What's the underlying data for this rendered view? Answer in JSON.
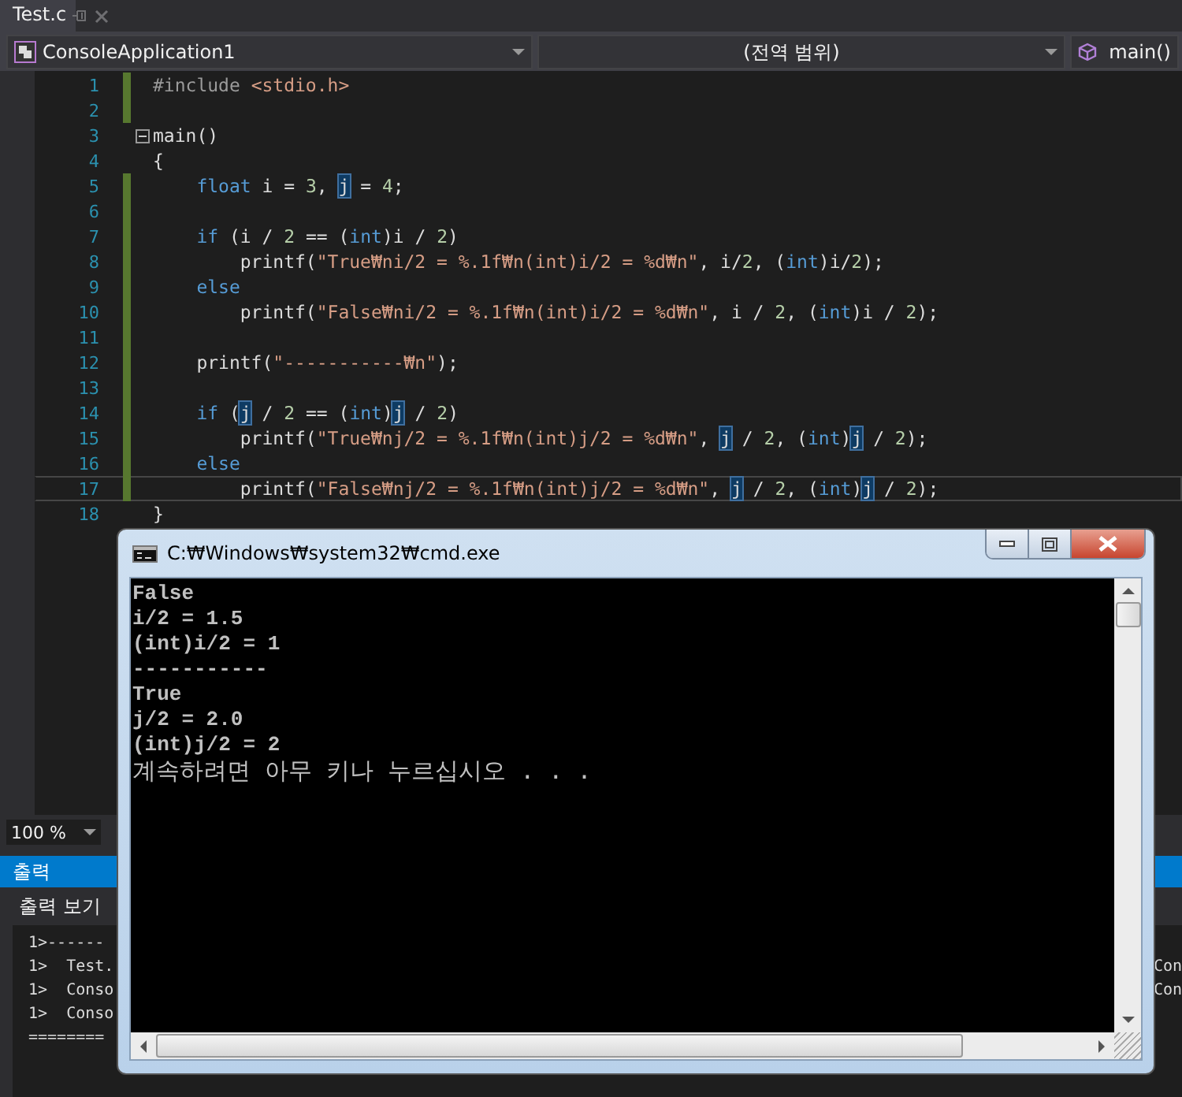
{
  "tab": {
    "title": "Test.c",
    "selected": true
  },
  "nav": {
    "project": "ConsoleApplication1",
    "scope": "(전역 범위)",
    "member": "main()"
  },
  "code_lines": [
    {
      "number": "1",
      "changed": true,
      "fold": false,
      "current": false,
      "tokens": [
        {
          "kind": "directive",
          "text": "#include "
        },
        {
          "kind": "string",
          "text": "<stdio.h>"
        }
      ]
    },
    {
      "number": "2",
      "changed": true,
      "fold": false,
      "current": false
    },
    {
      "number": "3",
      "changed": false,
      "fold": true,
      "current": false,
      "tokens": [
        {
          "kind": "plain",
          "text": "main()"
        }
      ]
    },
    {
      "number": "4",
      "changed": false,
      "fold": false,
      "current": false,
      "tokens": [
        {
          "kind": "plain",
          "text": "{"
        }
      ]
    },
    {
      "number": "5",
      "changed": true,
      "fold": false,
      "current": false,
      "tokens": [
        {
          "kind": "keyword",
          "text": "    float"
        },
        {
          "kind": "plain",
          "text": " i = "
        },
        {
          "kind": "number",
          "text": "3"
        },
        {
          "kind": "plain",
          "text": ", "
        },
        {
          "kind": "ref",
          "text": "j"
        },
        {
          "kind": "plain",
          "text": " = "
        },
        {
          "kind": "number",
          "text": "4"
        },
        {
          "kind": "plain",
          "text": ";"
        }
      ]
    },
    {
      "number": "6",
      "changed": true,
      "fold": false,
      "current": false
    },
    {
      "number": "7",
      "changed": true,
      "fold": false,
      "current": false,
      "tokens": [
        {
          "kind": "keyword",
          "text": "    if"
        },
        {
          "kind": "plain",
          "text": " (i / "
        },
        {
          "kind": "number",
          "text": "2"
        },
        {
          "kind": "plain",
          "text": " == ("
        },
        {
          "kind": "keyword",
          "text": "int"
        },
        {
          "kind": "plain",
          "text": ")i / "
        },
        {
          "kind": "number",
          "text": "2"
        },
        {
          "kind": "plain",
          "text": ")"
        }
      ]
    },
    {
      "number": "8",
      "changed": true,
      "fold": false,
      "current": false,
      "tokens": [
        {
          "kind": "plain",
          "text": "        printf("
        },
        {
          "kind": "string",
          "text": "\"True₩ni/2 = %.1f₩n(int)i/2 = %d₩n\""
        },
        {
          "kind": "plain",
          "text": ", i/"
        },
        {
          "kind": "number",
          "text": "2"
        },
        {
          "kind": "plain",
          "text": ", ("
        },
        {
          "kind": "keyword",
          "text": "int"
        },
        {
          "kind": "plain",
          "text": ")i/"
        },
        {
          "kind": "number",
          "text": "2"
        },
        {
          "kind": "plain",
          "text": ");"
        }
      ]
    },
    {
      "number": "9",
      "changed": true,
      "fold": false,
      "current": false,
      "tokens": [
        {
          "kind": "keyword",
          "text": "    else"
        }
      ]
    },
    {
      "number": "10",
      "changed": true,
      "fold": false,
      "current": false,
      "tokens": [
        {
          "kind": "plain",
          "text": "        printf("
        },
        {
          "kind": "string",
          "text": "\"False₩ni/2 = %.1f₩n(int)i/2 = %d₩n\""
        },
        {
          "kind": "plain",
          "text": ", i / "
        },
        {
          "kind": "number",
          "text": "2"
        },
        {
          "kind": "plain",
          "text": ", ("
        },
        {
          "kind": "keyword",
          "text": "int"
        },
        {
          "kind": "plain",
          "text": ")i / "
        },
        {
          "kind": "number",
          "text": "2"
        },
        {
          "kind": "plain",
          "text": ");"
        }
      ]
    },
    {
      "number": "11",
      "changed": true,
      "fold": false,
      "current": false
    },
    {
      "number": "12",
      "changed": true,
      "fold": false,
      "current": false,
      "tokens": [
        {
          "kind": "plain",
          "text": "    printf("
        },
        {
          "kind": "string",
          "text": "\"-----------₩n\""
        },
        {
          "kind": "plain",
          "text": ");"
        }
      ]
    },
    {
      "number": "13",
      "changed": true,
      "fold": false,
      "current": false
    },
    {
      "number": "14",
      "changed": true,
      "fold": false,
      "current": false,
      "tokens": [
        {
          "kind": "keyword",
          "text": "    if"
        },
        {
          "kind": "plain",
          "text": " ("
        },
        {
          "kind": "ref",
          "text": "j"
        },
        {
          "kind": "plain",
          "text": " / "
        },
        {
          "kind": "number",
          "text": "2"
        },
        {
          "kind": "plain",
          "text": " == ("
        },
        {
          "kind": "keyword",
          "text": "int"
        },
        {
          "kind": "plain",
          "text": ")"
        },
        {
          "kind": "ref",
          "text": "j"
        },
        {
          "kind": "plain",
          "text": " / "
        },
        {
          "kind": "number",
          "text": "2"
        },
        {
          "kind": "plain",
          "text": ")"
        }
      ]
    },
    {
      "number": "15",
      "changed": true,
      "fold": false,
      "current": false,
      "tokens": [
        {
          "kind": "plain",
          "text": "        printf("
        },
        {
          "kind": "string",
          "text": "\"True₩nj/2 = %.1f₩n(int)j/2 = %d₩n\""
        },
        {
          "kind": "plain",
          "text": ", "
        },
        {
          "kind": "ref",
          "text": "j"
        },
        {
          "kind": "plain",
          "text": " / "
        },
        {
          "kind": "number",
          "text": "2"
        },
        {
          "kind": "plain",
          "text": ", ("
        },
        {
          "kind": "keyword",
          "text": "int"
        },
        {
          "kind": "plain",
          "text": ")"
        },
        {
          "kind": "ref",
          "text": "j"
        },
        {
          "kind": "plain",
          "text": " / "
        },
        {
          "kind": "number",
          "text": "2"
        },
        {
          "kind": "plain",
          "text": ");"
        }
      ]
    },
    {
      "number": "16",
      "changed": true,
      "fold": false,
      "current": false,
      "tokens": [
        {
          "kind": "keyword",
          "text": "    else"
        }
      ]
    },
    {
      "number": "17",
      "changed": true,
      "fold": false,
      "current": true,
      "tokens": [
        {
          "kind": "plain",
          "text": "        printf("
        },
        {
          "kind": "string",
          "text": "\"False₩nj/2 = %.1f₩n(int)j/2 = %d₩n\""
        },
        {
          "kind": "plain",
          "text": ", "
        },
        {
          "kind": "ref",
          "text": "j"
        },
        {
          "kind": "plain",
          "text": " / "
        },
        {
          "kind": "number",
          "text": "2"
        },
        {
          "kind": "plain",
          "text": ", ("
        },
        {
          "kind": "keyword",
          "text": "int"
        },
        {
          "kind": "plain",
          "text": ")"
        },
        {
          "kind": "ref",
          "text": "j"
        },
        {
          "kind": "plain",
          "text": " / "
        },
        {
          "kind": "number",
          "text": "2"
        },
        {
          "kind": "plain",
          "text": ");"
        }
      ]
    },
    {
      "number": "18",
      "changed": false,
      "fold": false,
      "current": false,
      "tokens": [
        {
          "kind": "plain",
          "text": "}"
        }
      ]
    }
  ],
  "zoom": "100 %",
  "output_panel": {
    "title": "출력",
    "toolbar_label": "출력 보기",
    "lines": [
      "1>------",
      "1>  Test.",
      "1>  Conso",
      "1>  Conso",
      "========"
    ],
    "right_fragments": [
      "Con",
      "Con"
    ]
  },
  "console_window": {
    "title": "C:₩Windows₩system32₩cmd.exe",
    "lines": [
      "False",
      "i/2 = 1.5",
      "(int)i/2 = 1",
      "-----------",
      "True",
      "j/2 = 2.0",
      "(int)j/2 = 2"
    ],
    "prompt": "계속하려면 아무 키나 누르십시오 . . ."
  }
}
